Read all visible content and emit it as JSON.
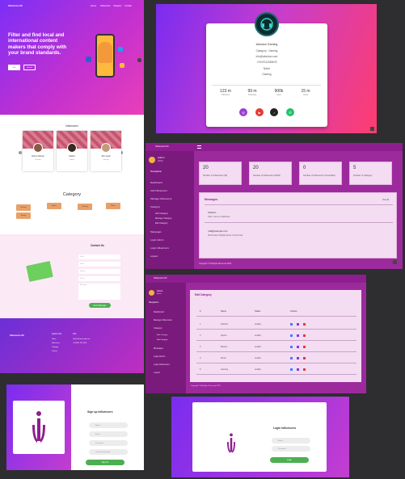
{
  "landing": {
    "brand": "Influencers Dir",
    "nav": [
      "Home",
      "Influencers",
      "Category",
      "Contact"
    ],
    "hero_title": "Filter and find local and international content makers that comply with your brand standards.",
    "hero_buttons": [
      "Join",
      "Search"
    ],
    "influencers_heading": "Influencers",
    "influencer_cards": [
      {
        "name": "Ezinne Daniels",
        "category": "Fashion"
      },
      {
        "name": "Rashid",
        "category": "Sports"
      },
      {
        "name": "John Lewis",
        "category": "Gaming"
      }
    ],
    "category_heading": "Category",
    "categories": [
      "Fashion",
      "Sports",
      "Gaming",
      "Music",
      "Beauty"
    ],
    "contact_heading": "Contact Us",
    "contact_fields": [
      "Name",
      "Email",
      "Subject",
      "Phone",
      "Message"
    ],
    "contact_submit": "Send Message",
    "footer_links_title": "Quick Link",
    "footer_links": [
      "Home",
      "Influencers",
      "Category",
      "Contact"
    ],
    "footer_info_title": "Info",
    "footer_info": [
      "info@influencersdir.com",
      "+234 801 234 5678"
    ]
  },
  "profile": {
    "name": "Abiodun Gaming",
    "category": "Category : Gaming",
    "email": "info@abiodun.com",
    "phone": "+2347012345678",
    "niche_label": "Niche",
    "niche": "Gaming",
    "stats": [
      {
        "value": "123 m",
        "label": "Followers"
      },
      {
        "value": "99 m",
        "label": "Following"
      },
      {
        "value": "900k",
        "label": "Likes"
      },
      {
        "value": "15 m",
        "label": "Views"
      }
    ],
    "socials": [
      {
        "icon": "instagram-icon",
        "glyph": "◎",
        "color": "#9b3ecf"
      },
      {
        "icon": "youtube-icon",
        "glyph": "▶",
        "color": "#e53935"
      },
      {
        "icon": "tiktok-icon",
        "glyph": "♪",
        "color": "#222222"
      },
      {
        "icon": "whatsapp-icon",
        "glyph": "✆",
        "color": "#25c26b"
      }
    ]
  },
  "dashboard": {
    "brand": "Influencers Dir",
    "admin_name": "Admin",
    "admin_role": "Admin",
    "nav_heading": "Navigation",
    "nav_items": [
      "Dashboard",
      "Add Influencers",
      "Manage Influencers",
      "Category",
      "Messages",
      "Login Admin",
      "Login Influencers",
      "Logout"
    ],
    "cat_sub": [
      "Add Category",
      "Manage Category",
      "Edit Category"
    ],
    "stat_cards": [
      {
        "value": "20",
        "label": "Number of Influencers (M)"
      },
      {
        "value": "20",
        "label": "Number of Influencers (Delhi)"
      },
      {
        "value": "0",
        "label": "Number of Influencers (Unverified)"
      },
      {
        "value": "5",
        "label": "Number of Category"
      }
    ],
    "messages_title": "Messages",
    "messages_view": "View all",
    "messages": [
      {
        "sender": "Abiodun",
        "body": "Hello I want to collaborate"
      },
      {
        "sender": "mail@example.com",
        "body": "Wednesday Highlight about a brand deal"
      }
    ],
    "footer": "Copyright © All Rights Reserved 2023"
  },
  "catlist": {
    "title": "Edit Category",
    "headers": [
      "#",
      "Name",
      "Status",
      "Actions"
    ],
    "rows": [
      {
        "n": "1",
        "name": "Fashion",
        "status": "enable"
      },
      {
        "n": "2",
        "name": "Sports",
        "status": "enable"
      },
      {
        "n": "3",
        "name": "Beauty",
        "status": "enable"
      },
      {
        "n": "4",
        "name": "Music",
        "status": "enable"
      },
      {
        "n": "5",
        "name": "Gaming",
        "status": "enable"
      }
    ],
    "footer": "Copyright © All Rights Reserved 2023"
  },
  "signup": {
    "title": "Sign up Influencers",
    "fields": [
      "Name",
      "Email",
      "Password",
      "Confirm Password"
    ],
    "submit": "Sign Up"
  },
  "login": {
    "title": "Login Influencers",
    "fields": [
      "Email",
      "Password"
    ],
    "submit": "Login"
  }
}
